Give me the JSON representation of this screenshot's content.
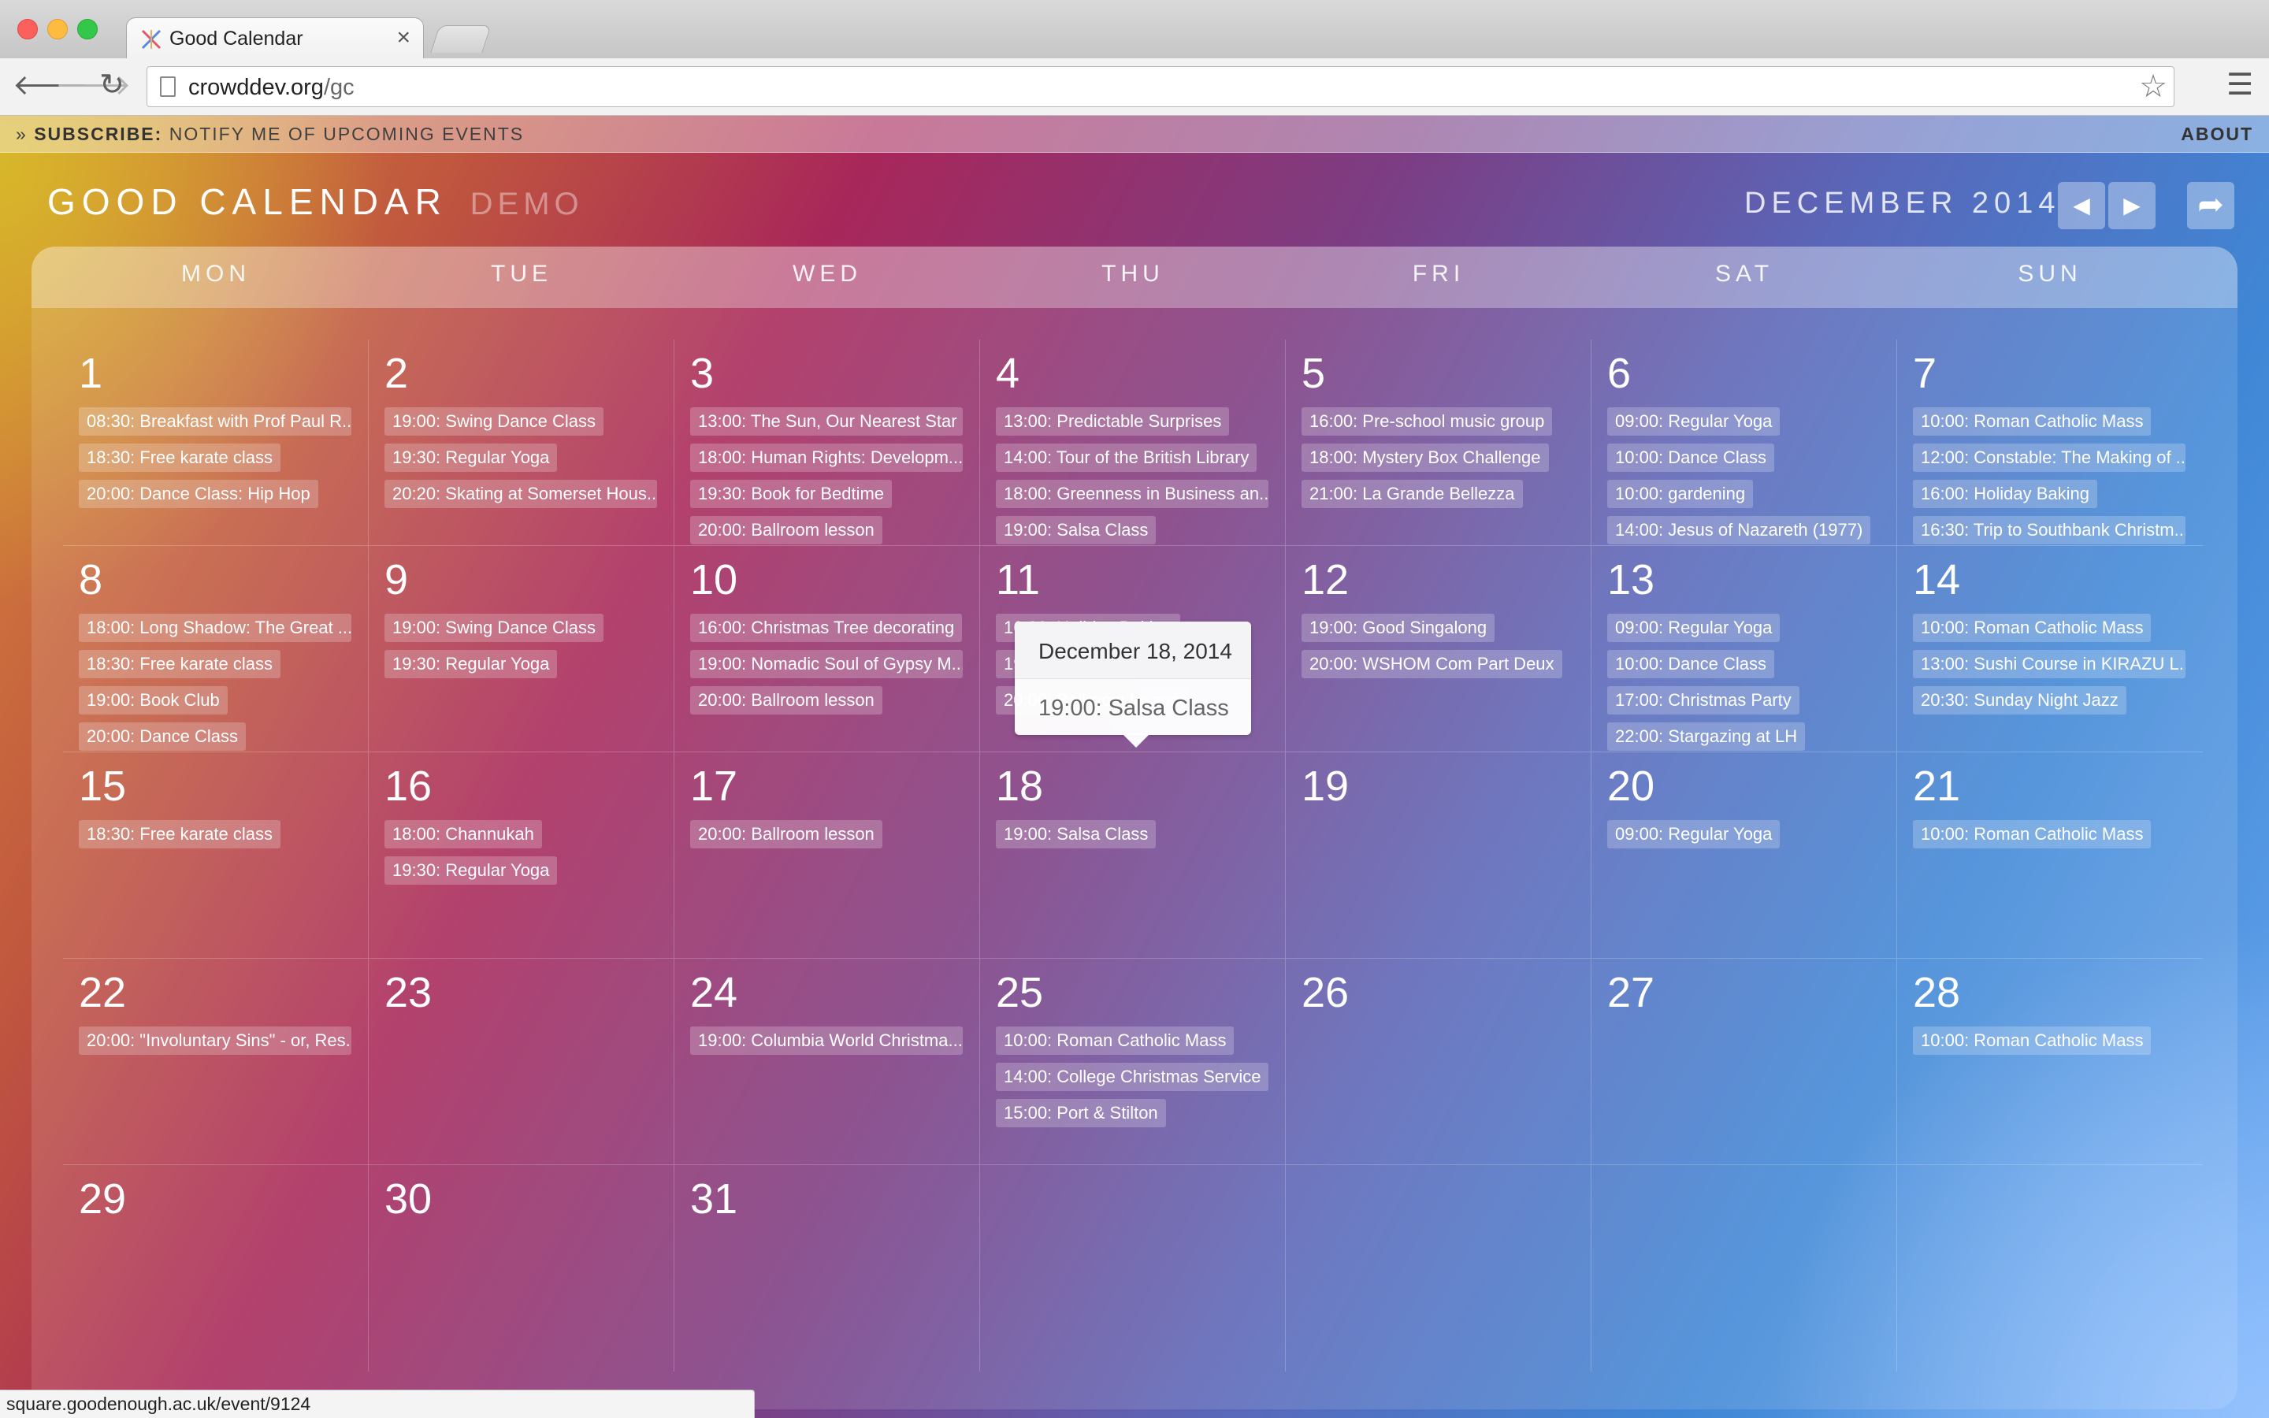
{
  "browser": {
    "tab_title": "Good Calendar",
    "tab_close_glyph": "×",
    "url_host": "crowddev.org",
    "url_path": "/gc",
    "status_url": "square.goodenough.ac.uk/event/9124",
    "icons": {
      "back": "arrow-left-icon",
      "forward": "arrow-right-icon",
      "reload": "reload-icon",
      "star": "star-icon",
      "menu": "hamburger-menu-icon"
    }
  },
  "subscribe_bar": {
    "prefix": "» ",
    "label": "SUBSCRIBE:",
    "text": " NOTIFY ME OF UPCOMING EVENTS",
    "about": "ABOUT"
  },
  "header": {
    "title": "GOOD CALENDAR",
    "subtitle": "DEMO",
    "month": "DECEMBER 2014",
    "prev_glyph": "◀",
    "next_glyph": "▶",
    "share_glyph": "➦"
  },
  "weekdays": [
    "MON",
    "TUE",
    "WED",
    "THU",
    "FRI",
    "SAT",
    "SUN"
  ],
  "weeks": [
    [
      {
        "day": "1",
        "events": [
          "08:30: Breakfast with Prof Paul R...",
          "18:30: Free karate class",
          "20:00: Dance Class: Hip Hop"
        ]
      },
      {
        "day": "2",
        "events": [
          "19:00: Swing Dance Class",
          "19:30: Regular Yoga",
          "20:20: Skating at Somerset Hous..."
        ]
      },
      {
        "day": "3",
        "events": [
          "13:00: The Sun, Our Nearest Star",
          "18:00: Human Rights: Developm...",
          "19:30: Book for Bedtime",
          "20:00: Ballroom lesson"
        ]
      },
      {
        "day": "4",
        "events": [
          "13:00: Predictable Surprises",
          "14:00: Tour of the British Library",
          "18:00: Greenness in Business an...",
          "19:00: Salsa Class"
        ]
      },
      {
        "day": "5",
        "events": [
          "16:00: Pre-school music group",
          "18:00: Mystery Box Challenge",
          "21:00: La Grande Bellezza"
        ]
      },
      {
        "day": "6",
        "events": [
          "09:00: Regular Yoga",
          "10:00: Dance Class",
          "10:00: gardening",
          "14:00: Jesus of Nazareth (1977)"
        ]
      },
      {
        "day": "7",
        "events": [
          "10:00: Roman Catholic Mass",
          "12:00: Constable: The Making of ...",
          "16:00: Holiday Baking",
          "16:30: Trip to Southbank Christm..."
        ]
      }
    ],
    [
      {
        "day": "8",
        "events": [
          "18:00: Long Shadow: The Great ...",
          "18:30: Free karate class",
          "19:00: Book Club",
          "20:00: Dance Class"
        ]
      },
      {
        "day": "9",
        "events": [
          "19:00: Swing Dance Class",
          "19:30: Regular Yoga"
        ]
      },
      {
        "day": "10",
        "events": [
          "16:00: Christmas Tree decorating",
          "19:00: Nomadic Soul of Gypsy M...",
          "20:00: Ballroom lesson"
        ]
      },
      {
        "day": "11",
        "events": [
          "16:00: Holiday Baking",
          "19:00: Salsa Class",
          "20:00: Ballroom lesson"
        ]
      },
      {
        "day": "12",
        "events": [
          "19:00: Good Singalong",
          "20:00: WSHOM Com Part Deux"
        ]
      },
      {
        "day": "13",
        "events": [
          "09:00: Regular Yoga",
          "10:00: Dance Class",
          "17:00: Christmas Party",
          "22:00: Stargazing at LH"
        ]
      },
      {
        "day": "14",
        "events": [
          "10:00: Roman Catholic Mass",
          "13:00: Sushi Course in KIRAZU L...",
          "20:30: Sunday Night Jazz"
        ]
      }
    ],
    [
      {
        "day": "15",
        "events": [
          "18:30: Free karate class"
        ]
      },
      {
        "day": "16",
        "events": [
          "18:00: Channukah",
          "19:30: Regular Yoga"
        ]
      },
      {
        "day": "17",
        "events": [
          "20:00: Ballroom lesson"
        ]
      },
      {
        "day": "18",
        "events": [
          "19:00: Salsa Class"
        ]
      },
      {
        "day": "19",
        "events": []
      },
      {
        "day": "20",
        "events": [
          "09:00: Regular Yoga"
        ]
      },
      {
        "day": "21",
        "events": [
          "10:00: Roman Catholic Mass"
        ]
      }
    ],
    [
      {
        "day": "22",
        "events": [
          "20:00: \"Involuntary Sins\" - or, Res..."
        ]
      },
      {
        "day": "23",
        "events": []
      },
      {
        "day": "24",
        "events": [
          "19:00: Columbia World Christma..."
        ]
      },
      {
        "day": "25",
        "events": [
          "10:00: Roman Catholic Mass",
          "14:00: College Christmas Service",
          "15:00: Port & Stilton"
        ]
      },
      {
        "day": "26",
        "events": []
      },
      {
        "day": "27",
        "events": []
      },
      {
        "day": "28",
        "events": [
          "10:00: Roman Catholic Mass"
        ]
      }
    ],
    [
      {
        "day": "29",
        "events": []
      },
      {
        "day": "30",
        "events": []
      },
      {
        "day": "31",
        "events": []
      },
      {
        "day": "",
        "events": []
      },
      {
        "day": "",
        "events": []
      },
      {
        "day": "",
        "events": []
      },
      {
        "day": "",
        "events": []
      }
    ]
  ],
  "popover": {
    "date": "December 18, 2014",
    "event": "19:00: Salsa Class"
  },
  "colors": {
    "gradient_yellow": "#d7b928",
    "gradient_magenta": "#a8275a",
    "gradient_purple": "#7c3d83",
    "gradient_blue": "#3f87d6",
    "gradient_light_blue": "#96c3ff",
    "text": "#ffffff"
  }
}
